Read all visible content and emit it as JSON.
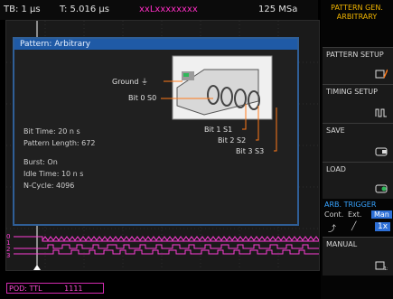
{
  "topbar": {
    "timebase": "TB: 1 µs",
    "trigger_time": "T: 5.016 µs",
    "trigger_source": "xxLxxxxxxxx",
    "sample_rate": "125 MSa"
  },
  "dialog": {
    "title": "Pattern: Arbitrary",
    "bit_time": "Bit Time: 20 n s",
    "pattern_length": "Pattern Length: 672",
    "burst": "Burst: On",
    "idle_time": "Idle Time: 10 n s",
    "n_cycle": "N-Cycle: 4096",
    "labels": {
      "ground": "Ground ⏚",
      "bit0": "Bit 0 S0",
      "bit1": "Bit 1 S1",
      "bit2": "Bit 2 S2",
      "bit3": "Bit 3 S3"
    }
  },
  "waveform_channels": [
    "0",
    "1",
    "2",
    "3"
  ],
  "pod": {
    "label": "POD: TTL",
    "indicator": "1111"
  },
  "side_menu": {
    "title_line1": "PATTERN GEN.",
    "title_line2": "ARBITRARY",
    "buttons": [
      {
        "label": "PATTERN SETUP",
        "icon": "pattern-setup-icon"
      },
      {
        "label": "TIMING SETUP",
        "icon": "timing-icon"
      },
      {
        "label": "SAVE",
        "icon": "save-icon"
      },
      {
        "label": "LOAD",
        "icon": "load-icon"
      }
    ],
    "arb_trigger": {
      "title": "ARB. TRIGGER",
      "options": [
        "Cont.",
        "Ext.",
        "Man"
      ],
      "selected": "Man",
      "row2": [
        "⤴",
        "╱",
        "1x"
      ]
    },
    "manual": {
      "label": "MANUAL",
      "icon": "manual-trigger-icon"
    }
  },
  "colors": {
    "accent_blue": "#1f5aa6",
    "digital_magenta": "#ff2dc4",
    "probe_orange": "#ff7a1a",
    "menu_title": "#f0b400"
  }
}
